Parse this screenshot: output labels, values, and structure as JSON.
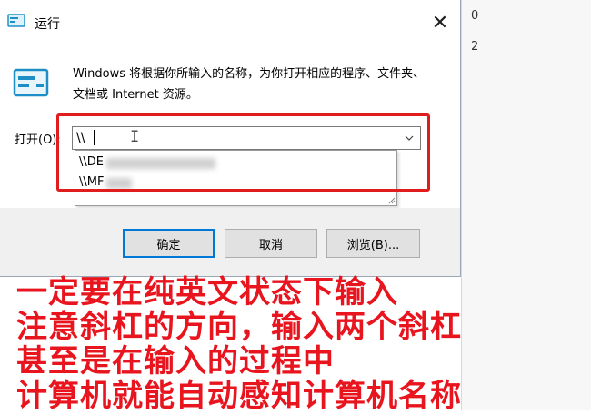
{
  "background": {
    "text_line1": "0",
    "text_line2": "2"
  },
  "dialog": {
    "title": "运行",
    "close_glyph": "✕",
    "description": "Windows 将根据你所输入的名称，为你打开相应的程序、文件夹、文档或 Internet 资源。",
    "open_label": "打开(O):",
    "input_value": "\\\\",
    "dropdown_items": [
      "\\\\DE",
      "\\\\MF"
    ],
    "buttons": {
      "ok": "确定",
      "cancel": "取消",
      "browse": "浏览(B)..."
    }
  },
  "caption": {
    "line1": "一定要在纯英文状态下输入",
    "line2": "注意斜杠的方向，输入两个斜杠",
    "line3": "甚至是在输入的过程中",
    "line4": "计算机就能自动感知计算机名称"
  },
  "icons": {
    "app": "run-icon",
    "close": "close-icon",
    "dropdown": "chevron-down-icon",
    "cursor": "text-cursor-icon"
  },
  "colors": {
    "highlight": "#e01c1c",
    "caption": "#e8141e",
    "accent": "#0078d7"
  }
}
